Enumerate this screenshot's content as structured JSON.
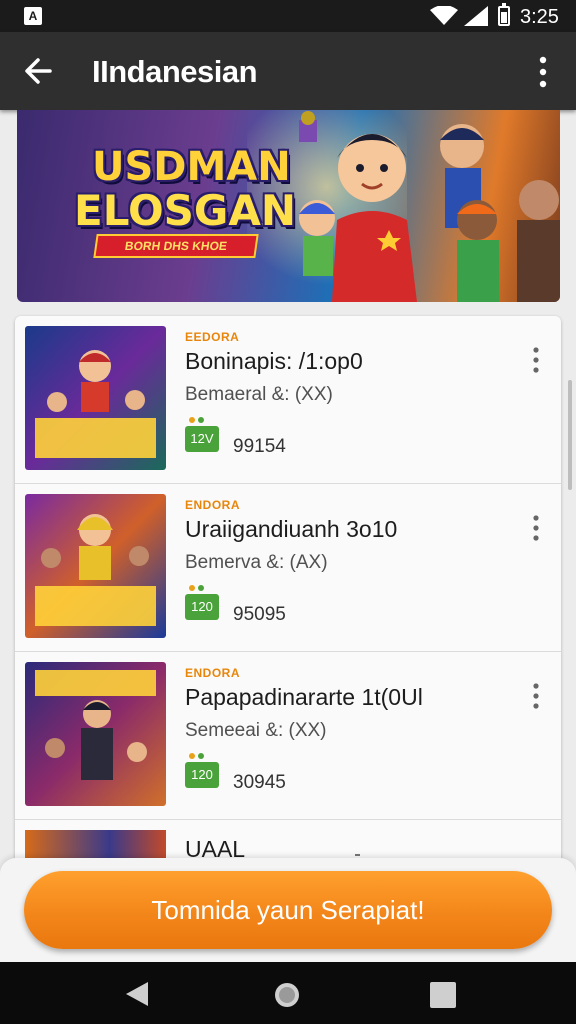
{
  "status_bar": {
    "notification_icon": "notification-icon",
    "notification_glyph": "A",
    "time": "3:25"
  },
  "app_bar": {
    "title": "IIndanesian",
    "back_icon": "arrow-left-icon",
    "menu_icon": "more-vert-icon"
  },
  "hero": {
    "title_line1": "USDMAN",
    "title_line2": "ELOSGAN",
    "ribbon": "BORH DHS KHOE"
  },
  "list": {
    "items": [
      {
        "tag": "EEDORA",
        "name": "Boninapis: /1:op0",
        "meta": "Bemaeral &: (XX)",
        "badge": "12V",
        "count": "99154",
        "thumb_text": "BANDMAN BARRAN"
      },
      {
        "tag": "ENDORA",
        "name": "Uraiigandiuanh 3o10",
        "meta": "Bemerva &: (AX)",
        "badge": "120",
        "count": "95095",
        "thumb_text": "EAMMANY ROMZ"
      },
      {
        "tag": "ENDORA",
        "name": "Papapadinararte 1t(0Ul",
        "meta": "Semeeai &: (XX)",
        "badge": "120",
        "count": "30945",
        "thumb_text": "PANALIAN BARRUAN"
      }
    ],
    "partial_item": {
      "name": "UAAL"
    }
  },
  "cta": {
    "label": "Tomnida yaun Serapiat!"
  },
  "colors": {
    "accent_orange": "#f3861a",
    "tag_orange": "#e8860c",
    "badge_green": "#4aa33a",
    "app_bar": "#2f2f2f"
  }
}
